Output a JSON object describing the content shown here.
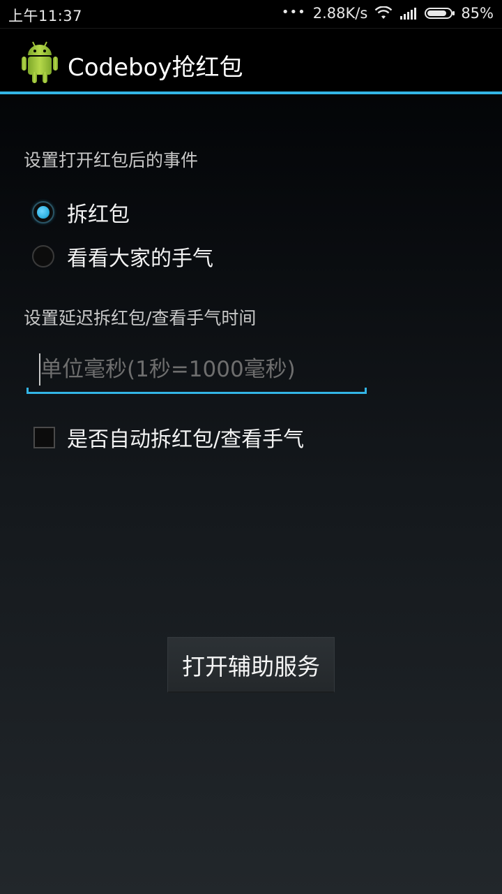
{
  "status_bar": {
    "time": "上午11:37",
    "dots": "•••",
    "net_speed": "2.88K/s",
    "battery": "85%",
    "battery_level": 0.85
  },
  "action_bar": {
    "title": "Codeboy抢红包",
    "icon": "android-robot-icon"
  },
  "settings": {
    "event_label": "设置打开红包后的事件",
    "radio_options": [
      {
        "label": "拆红包",
        "checked": true
      },
      {
        "label": "看看大家的手气",
        "checked": false
      }
    ],
    "delay_label": "设置延迟拆红包/查看手气时间",
    "delay_input": {
      "value": "",
      "placeholder": "单位毫秒(1秒=1000毫秒)"
    },
    "auto_checkbox": {
      "label": "是否自动拆红包/查看手气",
      "checked": false
    }
  },
  "service_button": {
    "label": "打开辅助服务"
  },
  "colors": {
    "accent": "#33b5e5",
    "background": "#000000",
    "android_green": "#a4c639"
  }
}
